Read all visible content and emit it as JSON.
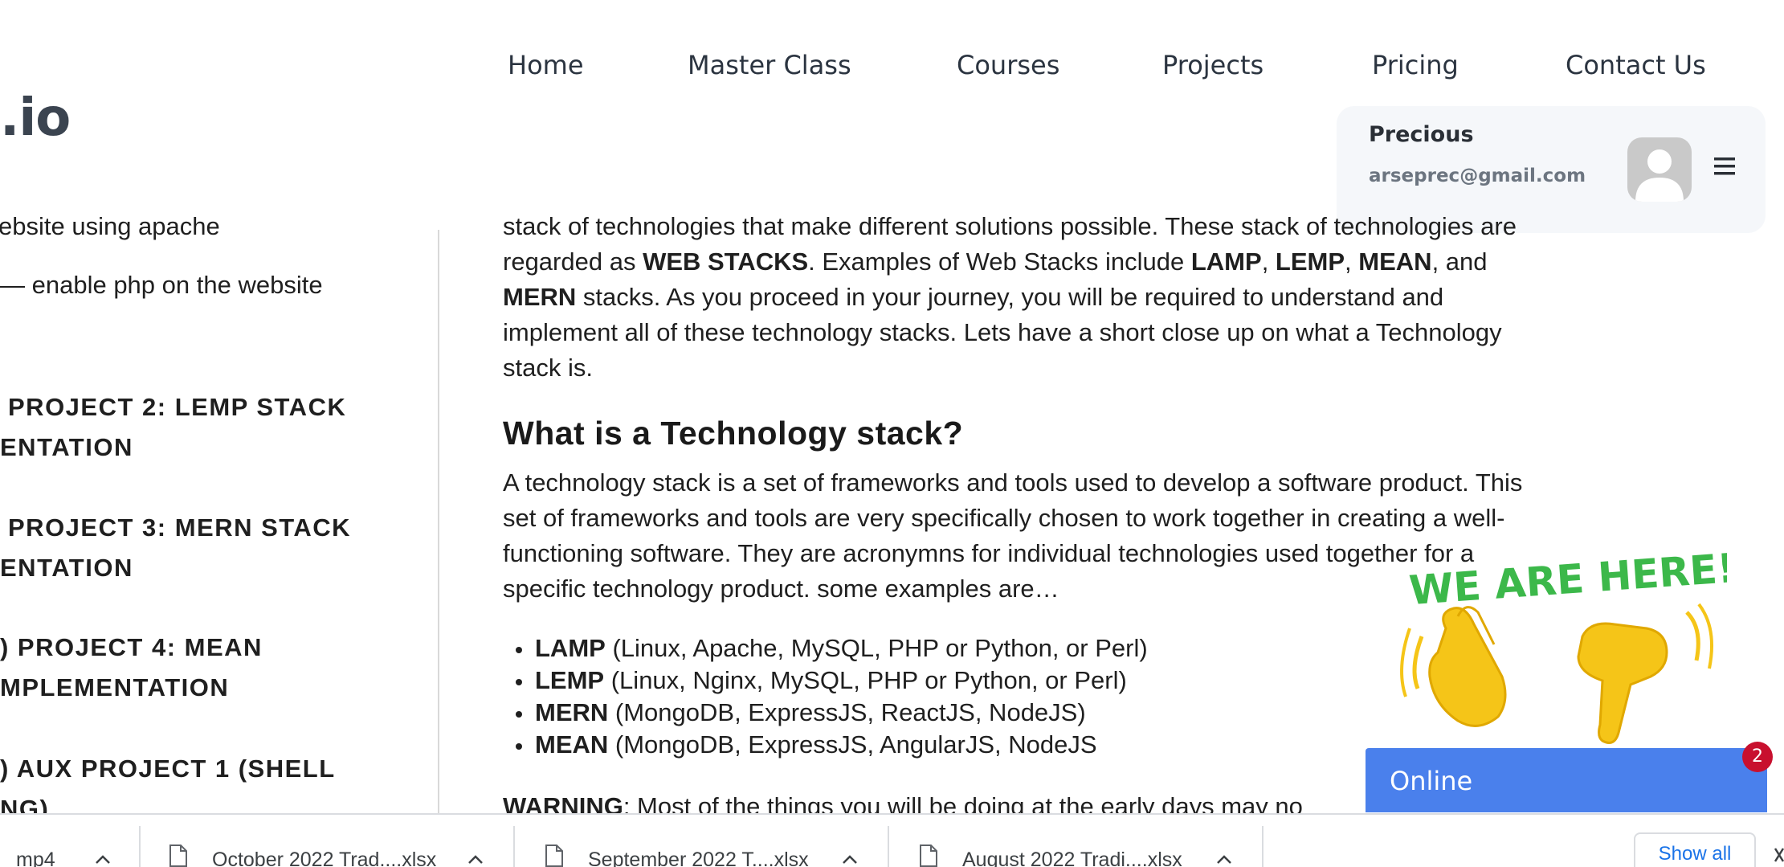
{
  "brand": {
    "logo_text": ".io"
  },
  "nav": {
    "items": [
      "Home",
      "Master Class",
      "Courses",
      "Projects",
      "Pricing",
      "Contact Us"
    ]
  },
  "user": {
    "name": "Precious",
    "email": "arseprec@gmail.com",
    "avatar_icon": "user-avatar-icon",
    "menu_icon": "hamburger-menu-icon"
  },
  "sidebar": {
    "lines": [
      "ebsite using apache",
      "— enable php on the website"
    ],
    "headings": [
      {
        "line1": "PROJECT 2: LEMP STACK",
        "line2": "ENTATION"
      },
      {
        "line1": "PROJECT 3: MERN STACK",
        "line2": "ENTATION"
      },
      {
        "line1": ") PROJECT 4: MEAN",
        "line2": "MPLEMENTATION"
      },
      {
        "line1": ") AUX PROJECT 1 (SHELL",
        "line2": "NG)"
      }
    ]
  },
  "article": {
    "intro": {
      "t1": "stack of technologies that make different solutions possible. These stack of technologies are",
      "t2": "regarded as ",
      "b1": "WEB STACKS",
      "t3": ". Examples of Web Stacks include ",
      "b2": "LAMP",
      "t4": ", ",
      "b3": "LEMP",
      "t5": ", ",
      "b4": "MEAN",
      "t6": ", and",
      "b5": "MERN",
      "t7": " stacks. As you proceed in your journey, you will be required to understand and",
      "t8": "implement all of these technology stacks. Lets have a short close up on what a Technology",
      "t9": "stack is."
    },
    "heading": "What is a Technology stack?",
    "para": {
      "l1": "A technology stack is a set of frameworks and tools used to develop a software product. This",
      "l2": "set of frameworks and tools are very specifically chosen to work together in creating a well-",
      "l3": "functioning software. They are acronymns for individual technologies used together for a",
      "l4": "specific technology product. some examples are…"
    },
    "bullets": [
      {
        "term": "LAMP",
        "desc": " (Linux, Apache, MySQL, PHP or Python, or Perl)"
      },
      {
        "term": "LEMP",
        "desc": " (Linux, Nginx, MySQL, PHP or Python, or Perl)"
      },
      {
        "term": "MERN",
        "desc": " (MongoDB, ExpressJS, ReactJS, NodeJS)"
      },
      {
        "term": "MEAN",
        "desc": " (MongoDB, ExpressJS, AngularJS, NodeJS"
      }
    ],
    "warning": {
      "label": "WARNING",
      "text": ": Most of the things you will be doing at the early days may no"
    }
  },
  "chat_widget": {
    "banner_text": "WE ARE HERE!",
    "status": "Online",
    "badge": "2"
  },
  "downloads": {
    "items": [
      {
        "name": "mp4"
      },
      {
        "name": "October 2022 Trad....xlsx"
      },
      {
        "name": "September 2022 T....xlsx"
      },
      {
        "name": "August 2022 Tradi....xlsx"
      }
    ],
    "show_all": "Show all"
  },
  "colors": {
    "accent": "#4a80ec",
    "badge": "#c8102e",
    "promo_green": "#3cb84a",
    "hand_yellow": "#f5c518"
  }
}
